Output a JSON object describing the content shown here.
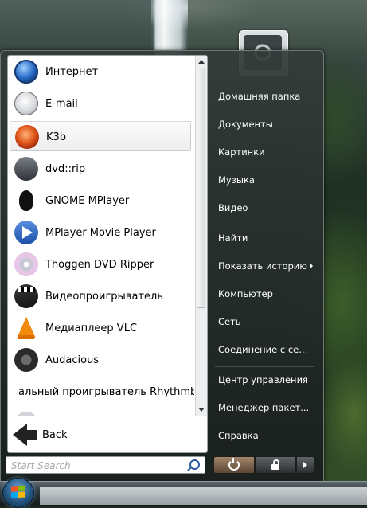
{
  "apps": [
    {
      "label": "Интернет",
      "icon": "internet-icon"
    },
    {
      "label": "E-mail",
      "icon": "email-icon"
    },
    {
      "label": "K3b",
      "icon": "k3b-icon"
    },
    {
      "label": "dvd::rip",
      "icon": "dvdrip-icon"
    },
    {
      "label": "GNOME MPlayer",
      "icon": "gnome-mplayer-icon"
    },
    {
      "label": "MPlayer Movie Player",
      "icon": "mplayer-icon"
    },
    {
      "label": "Thoggen DVD Ripper",
      "icon": "thoggen-icon"
    },
    {
      "label": "Видеопроигрыватель",
      "icon": "video-player-icon"
    },
    {
      "label": "Медиаплеер VLC",
      "icon": "vlc-icon"
    },
    {
      "label": "Audacious",
      "icon": "audacious-icon"
    },
    {
      "label": "альный проигрыватель Rhythmbox",
      "icon": "rhythmbox-icon"
    }
  ],
  "selected_app": "K3b",
  "back_label": "Back",
  "search": {
    "placeholder": "Start Search"
  },
  "places": [
    {
      "label": "Домашняя папка"
    },
    {
      "label": "Документы"
    },
    {
      "label": "Картинки"
    },
    {
      "label": "Музыка"
    },
    {
      "label": "Видео"
    },
    {
      "label": "Найти"
    },
    {
      "label": "Показать историю"
    },
    {
      "label": "Компьютер"
    },
    {
      "label": "Сеть"
    },
    {
      "label": "Соединение с се..."
    },
    {
      "label": "Центр управления"
    },
    {
      "label": "Менеджер пакет..."
    },
    {
      "label": "Справка"
    }
  ],
  "power_buttons": [
    "power-icon",
    "lock-icon",
    "arrow-right-icon"
  ],
  "colors": {
    "menu_text": "#ffffff",
    "selected_border": "#c9cccf",
    "power_button": "#8a6d52"
  }
}
